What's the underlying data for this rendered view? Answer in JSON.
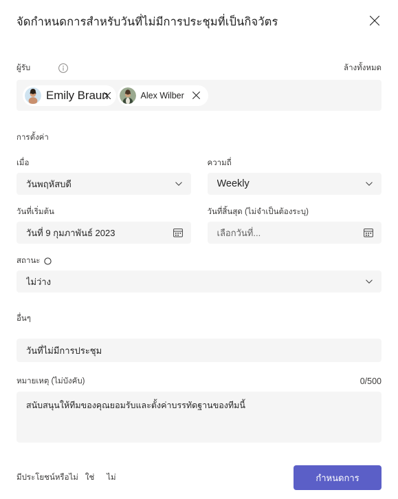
{
  "header": {
    "title": "จัดกำหนดการสำหรับวันที่ไม่มีการประชุมที่เป็นกิจวัตร",
    "close_icon": "close-icon"
  },
  "recipients": {
    "label": "ผู้รับ",
    "info_icon": "info-icon",
    "clear_all": "ล้างทั้งหมด",
    "chips": [
      {
        "name": "Emily Braun",
        "remove_icon": "close-icon"
      },
      {
        "name": "Alex Wilber",
        "remove_icon": "close-icon"
      }
    ]
  },
  "settings": {
    "section_title": "การตั้งค่า",
    "when": {
      "label": "เมื่อ",
      "value": "วันพฤหัสบดี",
      "chevron_icon": "chevron-down-icon"
    },
    "frequency": {
      "label": "ความถี่",
      "value": "Weekly",
      "chevron_icon": "chevron-down-icon"
    },
    "start_date": {
      "label": "วันที่เริ่มต้น",
      "value": "วันที่ 9 กุมภาพันธ์ 2023",
      "calendar_icon": "calendar-icon"
    },
    "end_date": {
      "label": "วันที่สิ้นสุด (ไม่จำเป็นต้องระบุ)",
      "placeholder": "เลือกวันที่...",
      "calendar_icon": "calendar-icon"
    },
    "status": {
      "label": "สถานะ",
      "label_icon": "status-circle-icon",
      "value": "ไม่ว่าง",
      "chevron_icon": "chevron-down-icon"
    }
  },
  "other": {
    "section_title": "อื่นๆ",
    "title_value": "วันที่ไม่มีการประชุม",
    "notes_label": "หมายเหตุ (ไม่บังคับ)",
    "notes_counter": "0/500",
    "notes_value": "สนับสนุนให้ทีมของคุณยอมรับและตั้งค่าบรรทัดฐานของทีมนี้"
  },
  "footer": {
    "feedback_question": "มีประโยชน์หรือไม่",
    "yes_label": "ใช่",
    "no_label": "ไม่",
    "primary_label": "กำหนดการ",
    "primary_color": "#5b5fc7"
  }
}
